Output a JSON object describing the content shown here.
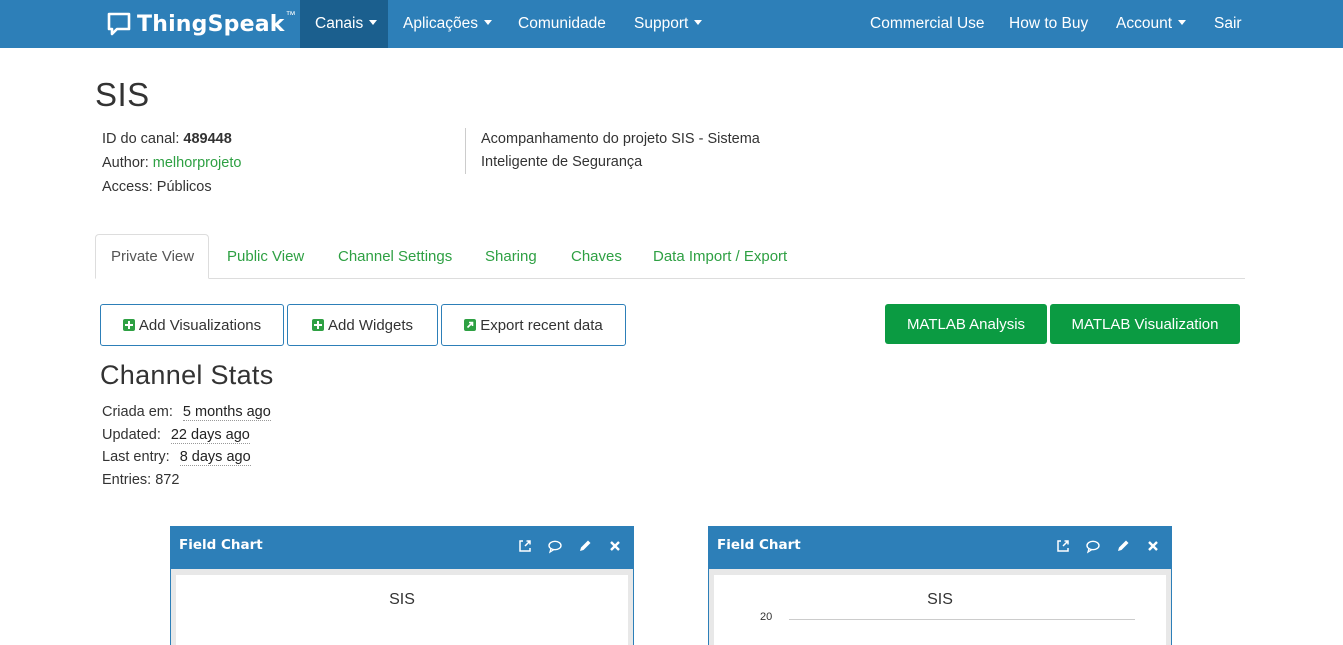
{
  "navbar": {
    "brand": "ThingSpeak",
    "brand_tm": "™",
    "left_items": [
      {
        "label": "Canais",
        "dropdown": true,
        "active": true
      },
      {
        "label": "Aplicações",
        "dropdown": true
      },
      {
        "label": "Comunidade",
        "dropdown": false
      },
      {
        "label": "Support",
        "dropdown": true
      }
    ],
    "right_items": [
      {
        "label": "Commercial Use"
      },
      {
        "label": "How to Buy"
      },
      {
        "label": "Account",
        "dropdown": true
      },
      {
        "label": "Sair"
      }
    ],
    "colors": {
      "background": "#2d7fb8",
      "active": "#1b5f8e"
    }
  },
  "channel": {
    "title": "SIS",
    "id_label": "ID do canal:",
    "id_value": "489448",
    "author_label": "Author:",
    "author_value": "melhorprojeto",
    "access_label": "Access:",
    "access_value": "Públicos",
    "description": "Acompanhamento do projeto SIS - Sistema Inteligente de Segurança"
  },
  "tabs": [
    {
      "label": "Private View",
      "active": true
    },
    {
      "label": "Public View"
    },
    {
      "label": "Channel Settings"
    },
    {
      "label": "Sharing"
    },
    {
      "label": "Chaves"
    },
    {
      "label": "Data Import / Export"
    }
  ],
  "actions": {
    "add_visualizations": "Add Visualizations",
    "add_widgets": "Add Widgets",
    "export_recent": "Export recent data",
    "matlab_analysis": "MATLAB Analysis",
    "matlab_visualization": "MATLAB Visualization",
    "colors": {
      "green": "#0b9b42",
      "link": "#2ea043"
    }
  },
  "stats": {
    "title": "Channel Stats",
    "created_label": "Criada em:",
    "created_value": "5 months ago",
    "updated_label": "Updated:",
    "updated_value": "22 days ago",
    "last_entry_label": "Last entry:",
    "last_entry_value": "8 days ago",
    "entries_label": "Entries:",
    "entries_value": "872"
  },
  "panels": [
    {
      "title": "Field Chart",
      "chart_title": "SIS",
      "tick": "",
      "icons": [
        "external-link-icon",
        "comment-icon",
        "pencil-icon",
        "close-icon"
      ]
    },
    {
      "title": "Field Chart",
      "chart_title": "SIS",
      "tick": "20",
      "icons": [
        "external-link-icon",
        "comment-icon",
        "pencil-icon",
        "close-icon"
      ]
    }
  ]
}
